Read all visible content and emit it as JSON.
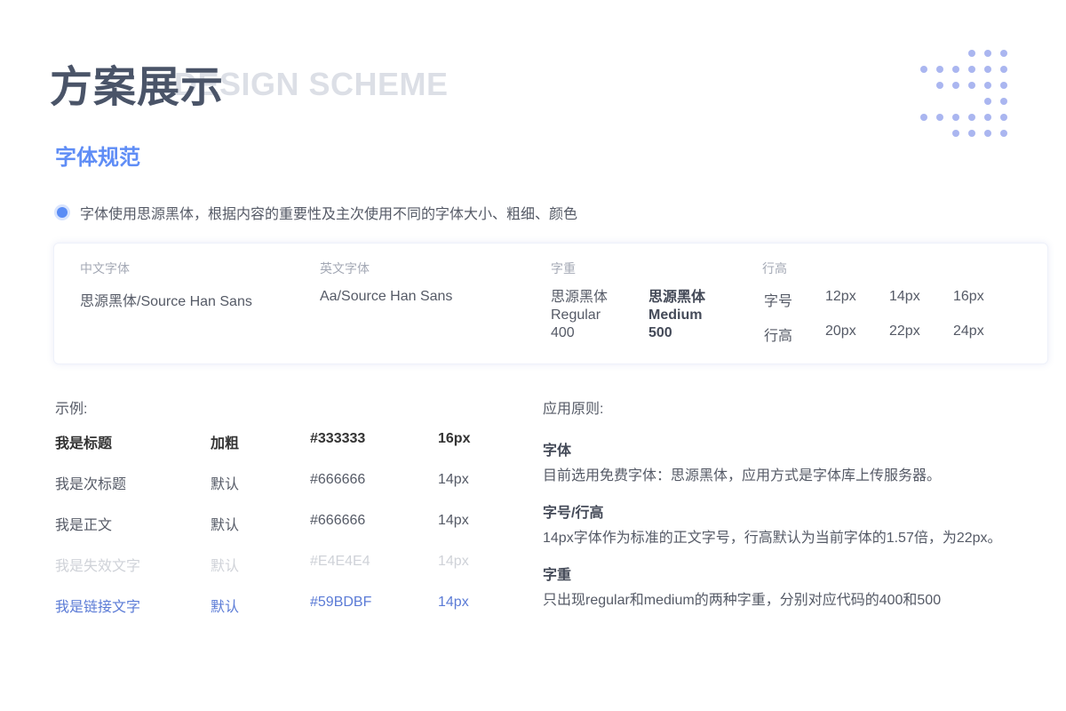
{
  "header": {
    "title": "方案展示",
    "bg_title": "DESIGN SCHEME",
    "section_title": "字体规范"
  },
  "intro": {
    "text": "字体使用思源黑体，根据内容的重要性及主次使用不同的字体大小、粗细、颜色"
  },
  "spec": {
    "cn_font_label": "中文字体",
    "cn_font_value": "思源黑体/Source Han Sans",
    "en_font_label": "英文字体",
    "en_font_value": "Aa/Source Han Sans",
    "weight_label": "字重",
    "weights": [
      {
        "name": "思源黑体",
        "style": "Regular",
        "code": "400"
      },
      {
        "name": "思源黑体",
        "style": "Medium",
        "code": "500"
      }
    ],
    "line_label": "行高",
    "size_row_label": "字号",
    "size_values": [
      "12px",
      "14px",
      "16px"
    ],
    "line_row_label": "行高",
    "line_values": [
      "20px",
      "22px",
      "24px"
    ]
  },
  "examples": {
    "label": "示例:",
    "rows": [
      {
        "name": "我是标题",
        "weight": "加粗",
        "color": "#333333",
        "size": "16px"
      },
      {
        "name": "我是次标题",
        "weight": "默认",
        "color": "#666666",
        "size": "14px"
      },
      {
        "name": "我是正文",
        "weight": "默认",
        "color": "#666666",
        "size": "14px"
      },
      {
        "name": "我是失效文字",
        "weight": "默认",
        "color": "#E4E4E4",
        "size": "14px"
      },
      {
        "name": "我是链接文字",
        "weight": "默认",
        "color": "#59BDBF",
        "size": "14px"
      }
    ]
  },
  "principles": {
    "label": "应用原则:",
    "items": [
      {
        "heading": "字体",
        "body": "目前选用免费字体：思源黑体，应用方式是字体库上传服务器。"
      },
      {
        "heading": "字号/行高",
        "body": "14px字体作为标准的正文字号，行高默认为当前字体的1.57倍，为22px。"
      },
      {
        "heading": "字重",
        "body": "只出现regular和medium的两种字重，分别对应代码的400和500"
      }
    ]
  },
  "colors": {
    "title": "#4a5468",
    "accent": "#5f8df6",
    "dots": "#aab6f0",
    "row_title": "#333333",
    "row_sub": "#555a66",
    "row_body": "#555a66",
    "row_disabled": "#cfd2d8",
    "row_link": "#5b7bd6"
  }
}
